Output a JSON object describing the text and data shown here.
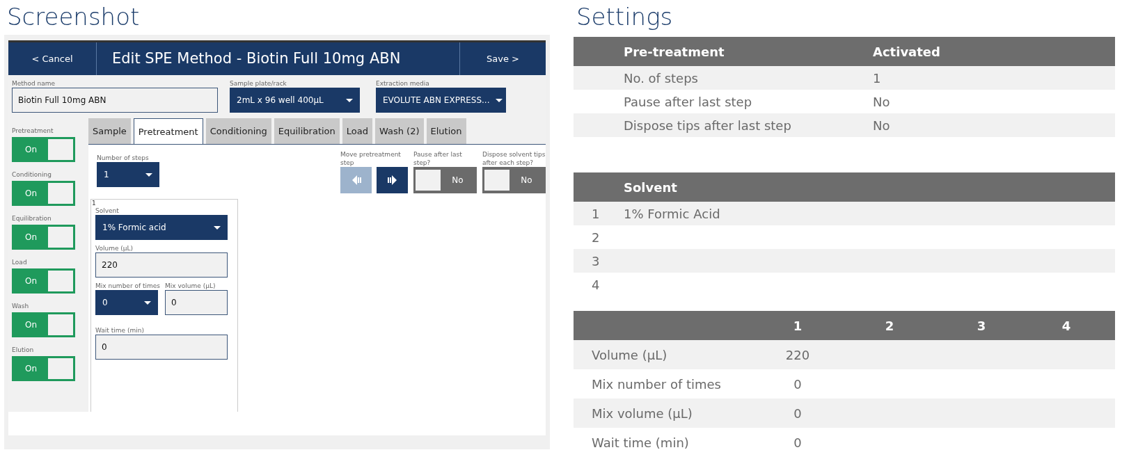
{
  "screenshot_panel": {
    "heading": "Screenshot",
    "header": {
      "cancel": "< Cancel",
      "title": "Edit SPE Method - Biotin Full 10mg ABN",
      "save": "Save >"
    },
    "fields": [
      {
        "label": "Method name",
        "value": "Biotin Full 10mg ABN",
        "kind": "text"
      },
      {
        "label": "Sample plate/rack",
        "value": "2mL x 96 well 400µL",
        "kind": "select"
      },
      {
        "label": "Extraction media",
        "value": "EVOLUTE ABN EXPRESS...",
        "kind": "select"
      }
    ],
    "step_toggles": [
      {
        "label": "Pretreatment",
        "text": "On",
        "on": true
      },
      {
        "label": "Conditioning",
        "text": "On",
        "on": true
      },
      {
        "label": "Equilibration",
        "text": "On",
        "on": true
      },
      {
        "label": "Load",
        "text": "On",
        "on": true
      },
      {
        "label": "Wash",
        "text": "On",
        "on": true
      },
      {
        "label": "Elution",
        "text": "On",
        "on": true
      }
    ],
    "tabs": [
      {
        "label": "Sample",
        "selected": false
      },
      {
        "label": "Pretreatment",
        "selected": true
      },
      {
        "label": "Conditioning",
        "selected": false
      },
      {
        "label": "Equilibration",
        "selected": false
      },
      {
        "label": "Load",
        "selected": false
      },
      {
        "label": "Wash (2)",
        "selected": false
      },
      {
        "label": "Elution",
        "selected": false
      }
    ],
    "steps": {
      "label": "Number of steps",
      "value": "1",
      "kind": "select"
    },
    "move": {
      "label": "Move pretreatment step",
      "buttons": [
        {
          "kind": "left",
          "disabled": true
        },
        {
          "kind": "right",
          "disabled": false
        }
      ]
    },
    "switches": [
      {
        "label": "Pause after last step?",
        "text": "No",
        "on": false
      },
      {
        "label": "Dispose solvent tips after each step?",
        "text": "No",
        "on": false
      }
    ],
    "step_card": {
      "index": "1",
      "rows": [
        [
          {
            "label": "Solvent",
            "value": "1% Formic acid",
            "kind": "select"
          }
        ],
        [
          {
            "label": "Volume (µL)",
            "value": "220",
            "kind": "text"
          }
        ],
        [
          {
            "label": "Mix number of times",
            "value": "0",
            "kind": "select"
          },
          {
            "label": "Mix volume (µL)",
            "value": "0",
            "kind": "text"
          }
        ],
        [
          {
            "label": "Wait time (min)",
            "value": "0",
            "kind": "text"
          }
        ]
      ]
    }
  },
  "settings_panel": {
    "heading": "Settings",
    "pretreatment_table": {
      "columns": [
        "Pre-treatment",
        "Activated"
      ],
      "rows": [
        [
          "No. of steps",
          "1"
        ],
        [
          "Pause after last step",
          "No"
        ],
        [
          "Dispose tips after last step",
          "No"
        ]
      ]
    },
    "solvent_table": {
      "column": "Solvent",
      "rows": [
        {
          "index": "1",
          "solvent": "1% Formic Acid"
        },
        {
          "index": "2"
        },
        {
          "index": "3"
        },
        {
          "index": "4"
        }
      ]
    },
    "step_table": {
      "columns": [
        "1",
        "2",
        "3",
        "4"
      ],
      "rows": [
        {
          "label": "Volume (µL)",
          "values": [
            "220"
          ]
        },
        {
          "label": "Mix number of times",
          "values": [
            "0"
          ]
        },
        {
          "label": "Mix volume (µL)",
          "values": [
            "0"
          ]
        },
        {
          "label": "Wait time (min)",
          "values": [
            "0"
          ]
        }
      ]
    }
  }
}
